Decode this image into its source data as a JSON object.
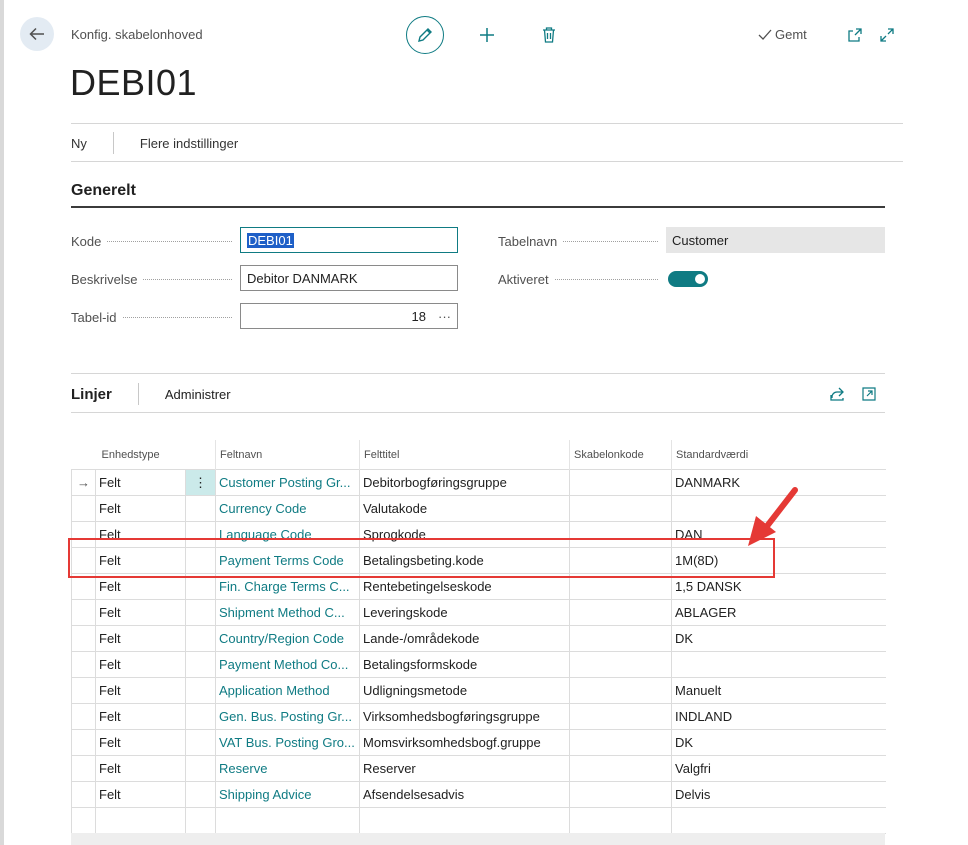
{
  "header": {
    "breadcrumb": "Konfig. skabelonhoved",
    "title": "DEBI01",
    "saved_status": "Gemt",
    "icons": [
      "back-arrow-icon",
      "pencil-icon",
      "plus-icon",
      "trash-icon",
      "check-icon",
      "open-new-window-icon",
      "expand-icon"
    ]
  },
  "actions": {
    "new": "Ny",
    "more": "Flere indstillinger"
  },
  "general": {
    "title": "Generelt",
    "code_label": "Kode",
    "code_value": "DEBI01",
    "description_label": "Beskrivelse",
    "description_value": "Debitor DANMARK",
    "table_id_label": "Tabel-id",
    "table_id_value": "18",
    "table_id_assist": "···",
    "table_name_label": "Tabelnavn",
    "table_name_value": "Customer",
    "enabled_label": "Aktiveret",
    "enabled": true
  },
  "lines": {
    "title": "Linjer",
    "manage": "Administrer",
    "columns": [
      "Enhedstype",
      "Feltnavn",
      "Felttitel",
      "Skabelonkode",
      "Standardværdi"
    ],
    "rows": [
      [
        "Felt",
        "Customer Posting Gr...",
        "Debitorbogføringsgruppe",
        "",
        "DANMARK"
      ],
      [
        "Felt",
        "Currency Code",
        "Valutakode",
        "",
        ""
      ],
      [
        "Felt",
        "Language Code",
        "Sprogkode",
        "",
        "DAN"
      ],
      [
        "Felt",
        "Payment Terms Code",
        "Betalingsbeting.kode",
        "",
        "1M(8D)"
      ],
      [
        "Felt",
        "Fin. Charge Terms C...",
        "Rentebetingelseskode",
        "",
        "1,5 DANSK"
      ],
      [
        "Felt",
        "Shipment Method C...",
        "Leveringskode",
        "",
        "ABLAGER"
      ],
      [
        "Felt",
        "Country/Region Code",
        "Lande-/områdekode",
        "",
        "DK"
      ],
      [
        "Felt",
        "Payment Method Co...",
        "Betalingsformskode",
        "",
        ""
      ],
      [
        "Felt",
        "Application Method",
        "Udligningsmetode",
        "",
        "Manuelt"
      ],
      [
        "Felt",
        "Gen. Bus. Posting Gr...",
        "Virksomhedsbogføringsgruppe",
        "",
        "INDLAND"
      ],
      [
        "Felt",
        "VAT Bus. Posting Gro...",
        "Momsvirksomhedsbogf.gruppe",
        "",
        "DK"
      ],
      [
        "Felt",
        "Reserve",
        "Reserver",
        "",
        "Valgfri"
      ],
      [
        "Felt",
        "Shipping Advice",
        "Afsendelsesadvis",
        "",
        "Delvis"
      ]
    ],
    "row_selector_glyph": "→",
    "row_menu_glyph": "⋮"
  },
  "colors": {
    "accent": "#0f7b83",
    "highlight": "#e53935",
    "selection": "#1e5fc7"
  }
}
